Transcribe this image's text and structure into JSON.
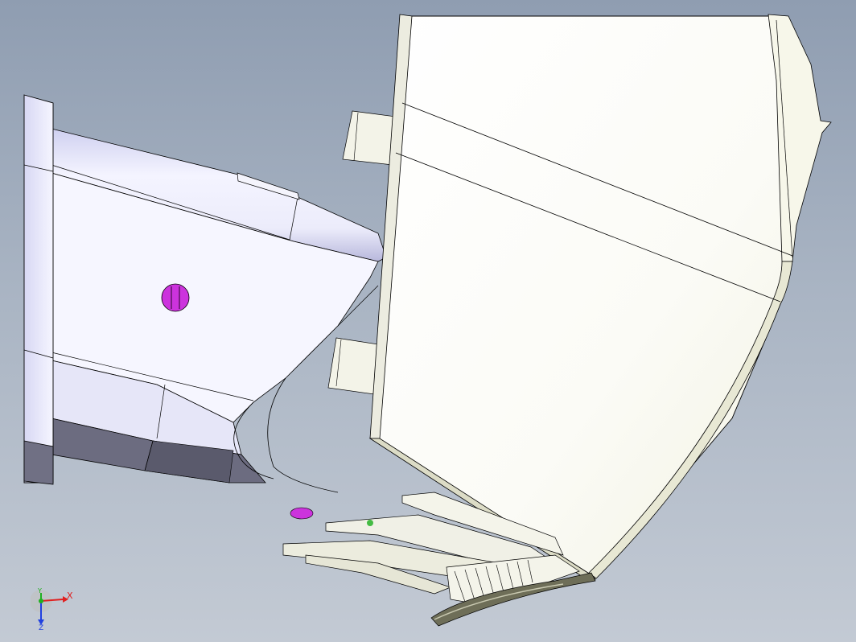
{
  "viewport": {
    "background_top": "#8f9db1",
    "background_bottom": "#c3cad4"
  },
  "model": {
    "part_colors": {
      "duct_light": "#eeeefb",
      "duct_mid": "#c8c8ea",
      "duct_dark": "#66667a",
      "hopper_face": "#fbfbf3",
      "hopper_edge": "#e6e6c8",
      "fastener": "#cc33dd",
      "trim": "#6e6e58",
      "rib": "#f2f2e6"
    }
  },
  "triad": {
    "x_label": "X",
    "y_label": "Y",
    "z_label": "Z",
    "x_color": "#e02020",
    "y_color": "#20b020",
    "z_color": "#2040e0"
  }
}
